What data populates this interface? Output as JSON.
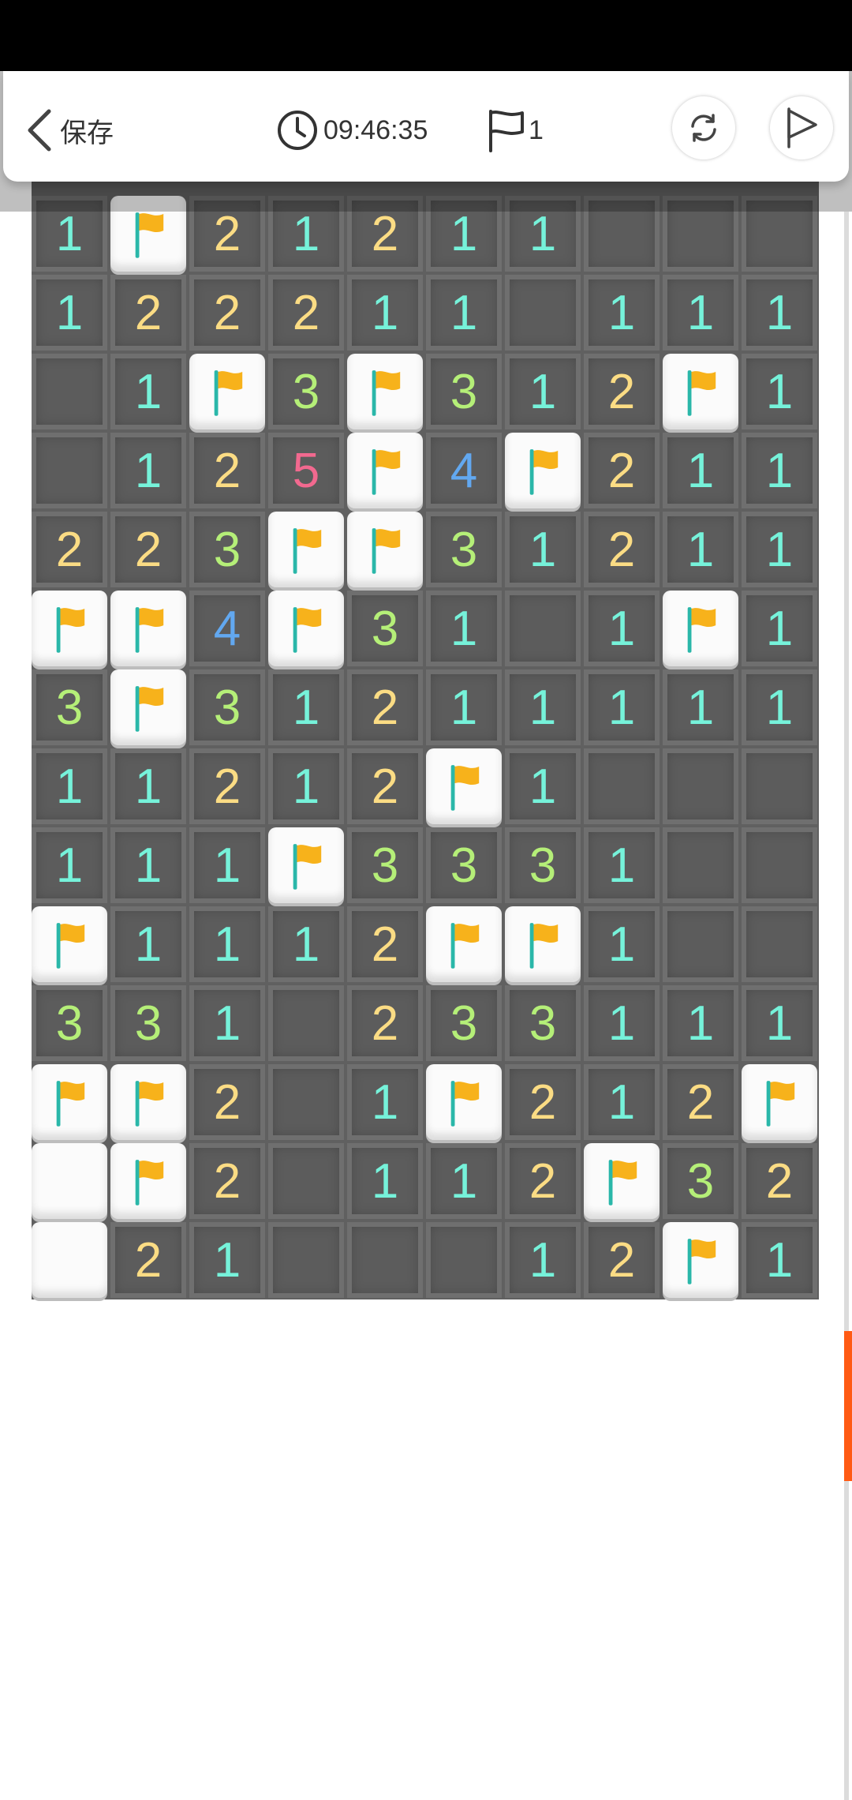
{
  "header": {
    "back_label": "保存",
    "timer": "09:46:35",
    "flag_count": "1"
  },
  "icons": {
    "back": "chevron-left-icon",
    "timer": "clock-icon",
    "flags": "flag-outline-icon",
    "refresh": "refresh-icon",
    "flag_mode": "play-flag-icon"
  },
  "colors": {
    "1": "#76f2da",
    "2": "#fbdc84",
    "3": "#b5ef78",
    "4": "#62a8f0",
    "5": "#f2698f",
    "scroll_thumb": "#ff5a14",
    "flag": "#f7b21b",
    "flag_pole": "#2ab7a9"
  },
  "board": {
    "cols": 10,
    "rows": [
      [
        "1",
        "F",
        "2",
        "1",
        "2",
        "1",
        "1",
        "E",
        "E",
        "E"
      ],
      [
        "1",
        "2",
        "2",
        "2",
        "1",
        "1",
        "E",
        "1",
        "1",
        "1"
      ],
      [
        "E",
        "1",
        "F",
        "3",
        "F",
        "3",
        "1",
        "2",
        "F",
        "1"
      ],
      [
        "E",
        "1",
        "2",
        "5",
        "F",
        "4",
        "F",
        "2",
        "1",
        "1"
      ],
      [
        "2",
        "2",
        "3",
        "F",
        "F",
        "3",
        "1",
        "2",
        "1",
        "1"
      ],
      [
        "F",
        "F",
        "4",
        "F",
        "3",
        "1",
        "E",
        "1",
        "F",
        "1"
      ],
      [
        "3",
        "F",
        "3",
        "1",
        "2",
        "1",
        "1",
        "1",
        "1",
        "1"
      ],
      [
        "1",
        "1",
        "2",
        "1",
        "2",
        "F",
        "1",
        "E",
        "E",
        "E"
      ],
      [
        "1",
        "1",
        "1",
        "F",
        "3",
        "3",
        "3",
        "1",
        "E",
        "E"
      ],
      [
        "F",
        "1",
        "1",
        "1",
        "2",
        "F",
        "F",
        "1",
        "E",
        "E"
      ],
      [
        "3",
        "3",
        "1",
        "E",
        "2",
        "3",
        "3",
        "1",
        "1",
        "1"
      ],
      [
        "F",
        "F",
        "2",
        "E",
        "1",
        "F",
        "2",
        "1",
        "2",
        "F"
      ],
      [
        "U",
        "F",
        "2",
        "E",
        "1",
        "1",
        "2",
        "F",
        "3",
        "2"
      ],
      [
        "U",
        "2",
        "1",
        "E",
        "E",
        "E",
        "1",
        "2",
        "F",
        "1"
      ]
    ]
  }
}
